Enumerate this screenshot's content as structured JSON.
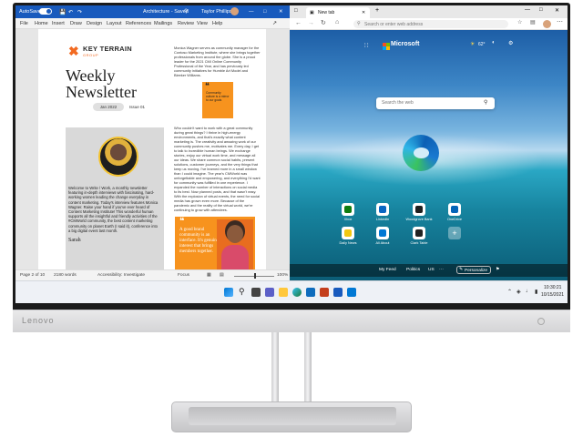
{
  "word": {
    "autosave_label": "AutoSave",
    "autosave_state": "ON",
    "doc_title": "Architecture - Saved",
    "user_name": "Taylor Phillips",
    "menu": [
      "File",
      "Home",
      "Insert",
      "Draw",
      "Design",
      "Layout",
      "References",
      "Mailings",
      "Review",
      "View",
      "Help"
    ],
    "newsletter": {
      "brand": "KEY TERRAIN",
      "brand_sub": "GROUP",
      "title": "Weekly Newsletter",
      "date": "Jan 2022",
      "issue": "Issue 01",
      "intro": "Monica Wagner serves as community manager for the Contoso Marketing Institute, where she brings together professionals from around the globe. She is a proud leader for the 2021 CMI Online Community Professional of the Year, and has previously led community initiatives for Humble Art Model and Bleeker Williams.",
      "quote1": "Community culture is a mirror to our goals",
      "body": "Who couldn't want to work with a great community during great things? I thrive in high-energy environments, and that's exactly what content marketing is. The creativity and amazing work of our community pushes me, motivates me. Every day, I get to talk to incredible human beings. We exchange stories, enjoy our virtual work time, and message all our ideas. We share common social habits, present solutions, customer journeys, and the very things that keep us moving. I've learned more in a small window than I could imagine. The year's CMWorld was unforgettable and empowering, and everything I'd want for community was fulfilled in one experience. I expanded the number of interactions on social media to its best. Now planned posts, and that wasn't easy. With the explosion of virtual events, the need for social media has grown even more. Because of the pandemic and the reality of the virtual world, we're continuing to grow with attendees.",
      "bio": "Welcome to Write / Work, a monthly newsletter featuring in-depth interviews with fascinating, hard-working women leading the change everyday in content marketing. Today's interview features Monica Wagner. Raise your hand if you've ever heard of Content Marketing Institute! This wonderful human supports all the insightful and friendly activities of the #CMWorld community, the best content marketing community on planet Earth (I said it), conference into a big digital event last month.",
      "signoff": "Sarah",
      "quote2": "A good brand community is an interface. It's genuine interest that brings members together."
    },
    "status": {
      "page": "Page 2 of 10",
      "words": "2180 words",
      "accessibility": "Accessibility: Investigate",
      "focus": "Focus",
      "zoom": "100%"
    }
  },
  "edge": {
    "tab_title": "New tab",
    "address_placeholder": "Search or enter web address",
    "brand": "Microsoft",
    "weather": "62°",
    "search_placeholder": "Search the web",
    "tiles": [
      {
        "label": "Xbox",
        "color": "#107c10"
      },
      {
        "label": "LinkedIn",
        "color": "#0a66c2"
      },
      {
        "label": "Woodgrove Bank",
        "color": "#1f1f1f"
      },
      {
        "label": "OneDrive",
        "color": "#0364b8"
      },
      {
        "label": "Daily News",
        "color": "#f2c811"
      },
      {
        "label": "All About",
        "color": "#0078d4"
      },
      {
        "label": "Clark Table",
        "color": "#222222"
      },
      {
        "label": "+",
        "color": "#ffffff"
      }
    ],
    "feed_tabs": [
      "My Feed",
      "Politics",
      "US"
    ],
    "personalize": "Personalize"
  },
  "taskbar": {
    "time": "10:30:21",
    "date": "10/15/2021"
  },
  "monitor": {
    "brand": "Lenovo"
  }
}
